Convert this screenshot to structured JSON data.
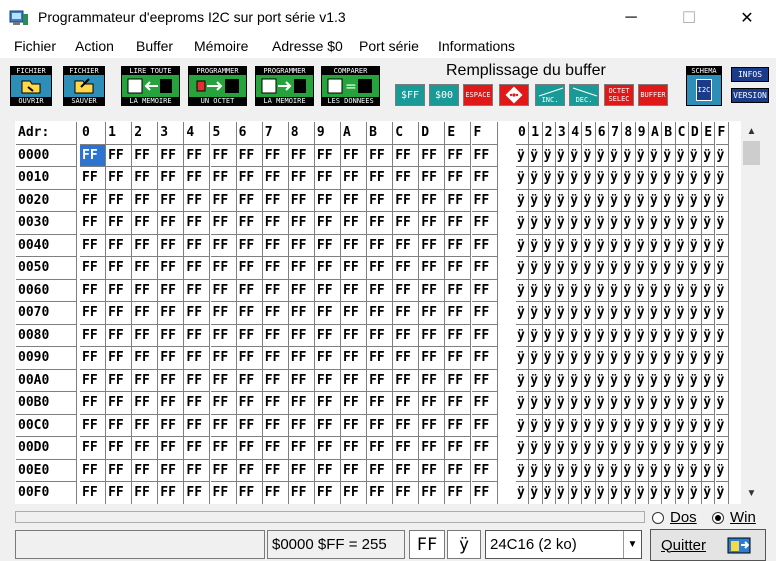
{
  "window": {
    "title": "Programmateur d'eeproms I2C sur port série v1.3",
    "minimize_glyph": "─",
    "maximize_glyph": "☐",
    "close_glyph": "✕"
  },
  "menu": [
    "Fichier",
    "Action",
    "Buffer",
    "Mémoire",
    "Adresse $0",
    "Port série",
    "Informations"
  ],
  "toolbar": {
    "file_open": {
      "top": "FICHIER",
      "bottom": "OUVRIR"
    },
    "file_save": {
      "top": "FICHIER",
      "bottom": "SAUVER"
    },
    "read_all": {
      "top": "LIRE TOUTE",
      "bottom": "LA MEMOIRE"
    },
    "prog_byte": {
      "top": "PROGRAMMER",
      "bottom": "UN OCTET"
    },
    "prog_mem": {
      "top": "PROGRAMMER",
      "bottom": "LA MEMOIRE"
    },
    "compare": {
      "top": "COMPARER",
      "bottom": "LES DONNEES"
    },
    "schema": {
      "top": "SCHEMA",
      "pic": "I2C"
    },
    "infos": "INFOS",
    "version": "VERSION"
  },
  "fill": {
    "title": "Remplissage du buffer",
    "ff": "$FF",
    "zero": "$00",
    "space": "ESPACE",
    "random_icon": "dice-icon",
    "inc": "INC.",
    "dec": "DEC.",
    "octet1": "OCTET",
    "octet2": "SELEC",
    "buffer": "BUFFER",
    "colors": {
      "teal": "#1a9a96",
      "red": "#e01818"
    }
  },
  "grid": {
    "addr_header": "Adr:",
    "hex_headers": [
      "0",
      "1",
      "2",
      "3",
      "4",
      "5",
      "6",
      "7",
      "8",
      "9",
      "A",
      "B",
      "C",
      "D",
      "E",
      "F"
    ],
    "addresses": [
      "0000",
      "0010",
      "0020",
      "0030",
      "0040",
      "0050",
      "0060",
      "0070",
      "0080",
      "0090",
      "00A0",
      "00B0",
      "00C0",
      "00D0",
      "00E0",
      "00F0"
    ],
    "byte_value": "FF",
    "ascii_char": "ÿ",
    "selected": {
      "row": 0,
      "col": 0
    }
  },
  "radios": {
    "dos": "Dos",
    "win": "Win",
    "selected": "win"
  },
  "status": {
    "info": "$0000  $FF = 255",
    "hex": "FF",
    "char": "ÿ",
    "chip": "24C16 (2 ko)",
    "dropdown_glyph": "▼",
    "quit": "Quitter"
  }
}
